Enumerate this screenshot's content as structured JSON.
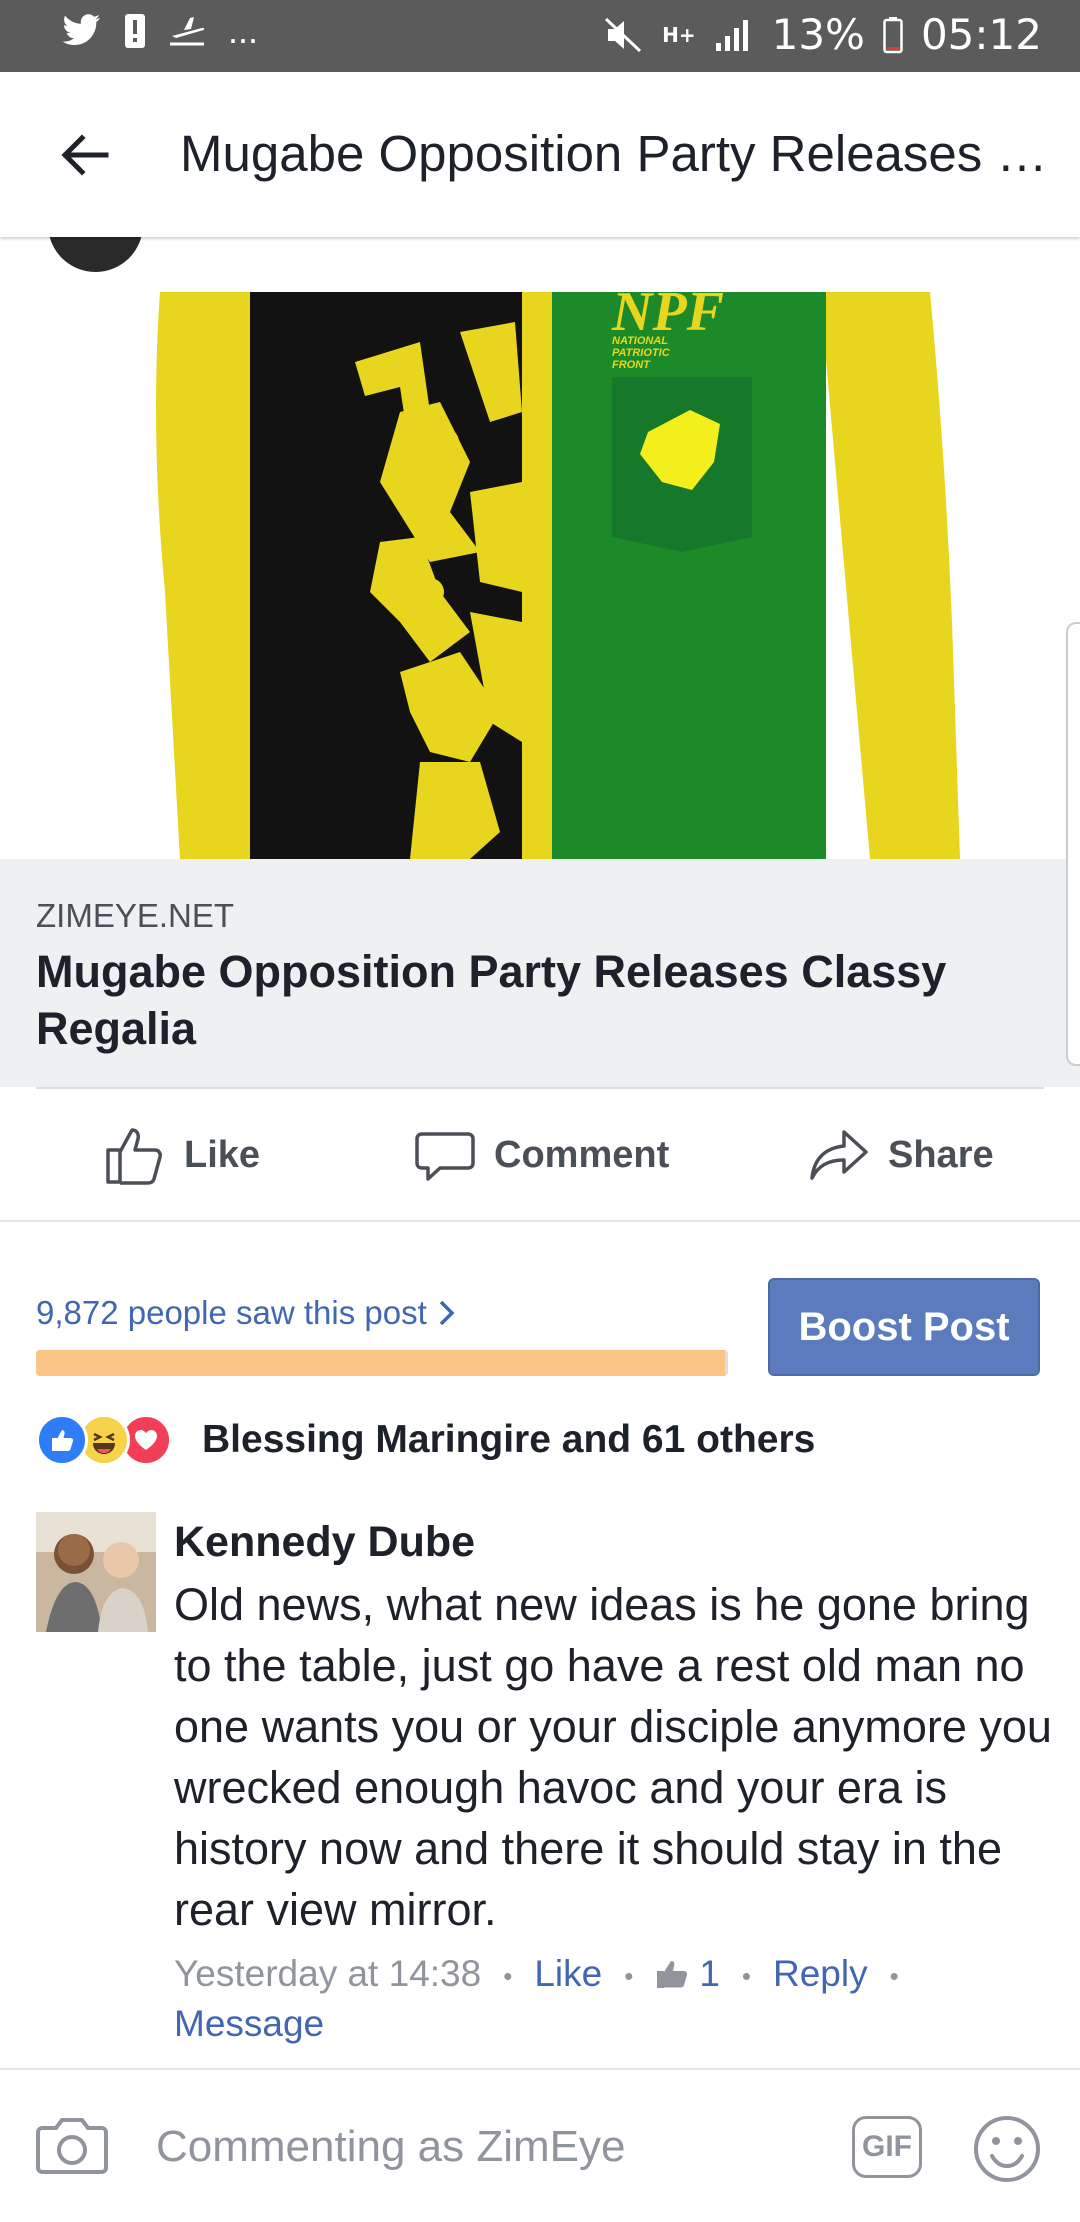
{
  "status_bar": {
    "left_icons": [
      "twitter-icon",
      "alert-icon",
      "airplane-icon"
    ],
    "more": "...",
    "signal_labels": "H+",
    "battery_percent": "13%",
    "time": "05:12"
  },
  "appbar": {
    "title": "Mugabe Opposition Party Releases Classy Regalia"
  },
  "post": {
    "image_text": {
      "logo": "NPF",
      "line1": "NATIONAL",
      "line2": "PATRIOTIC",
      "line3": "FRONT"
    },
    "link": {
      "domain": "ZIMEYE.NET",
      "title": "Mugabe Opposition Party Releases Classy Regalia"
    },
    "actions": {
      "like": "Like",
      "comment": "Comment",
      "share": "Share"
    },
    "insights": {
      "seen": "9,872 people saw this post",
      "progress_fraction": 0.995,
      "boost_label": "Boost Post"
    },
    "reactions": {
      "text": "Blessing Maringire and 61 others",
      "types": [
        "like-icon",
        "haha-icon",
        "love-icon"
      ]
    }
  },
  "comment": {
    "author": "Kennedy Dube",
    "text": "Old news, what new ideas is he gone bring to the table, just go have a rest old man no one wants you or your disciple anymore you wrecked enough havoc and your era is history now and there it should stay in the rear view mirror.",
    "time": "Yesterday at 14:38",
    "like": "Like",
    "like_count": "1",
    "reply": "Reply",
    "message": "Message"
  },
  "composer": {
    "placeholder": "Commenting as ZimEye",
    "gif_label": "GIF"
  },
  "colors": {
    "facebook_blue": "#4267b2",
    "boost_button": "#5b7bbd",
    "progress_fill": "#fbc586",
    "shirt_yellow": "#e8d51e",
    "shirt_green": "#1d8a2a",
    "shirt_black": "#121212"
  }
}
